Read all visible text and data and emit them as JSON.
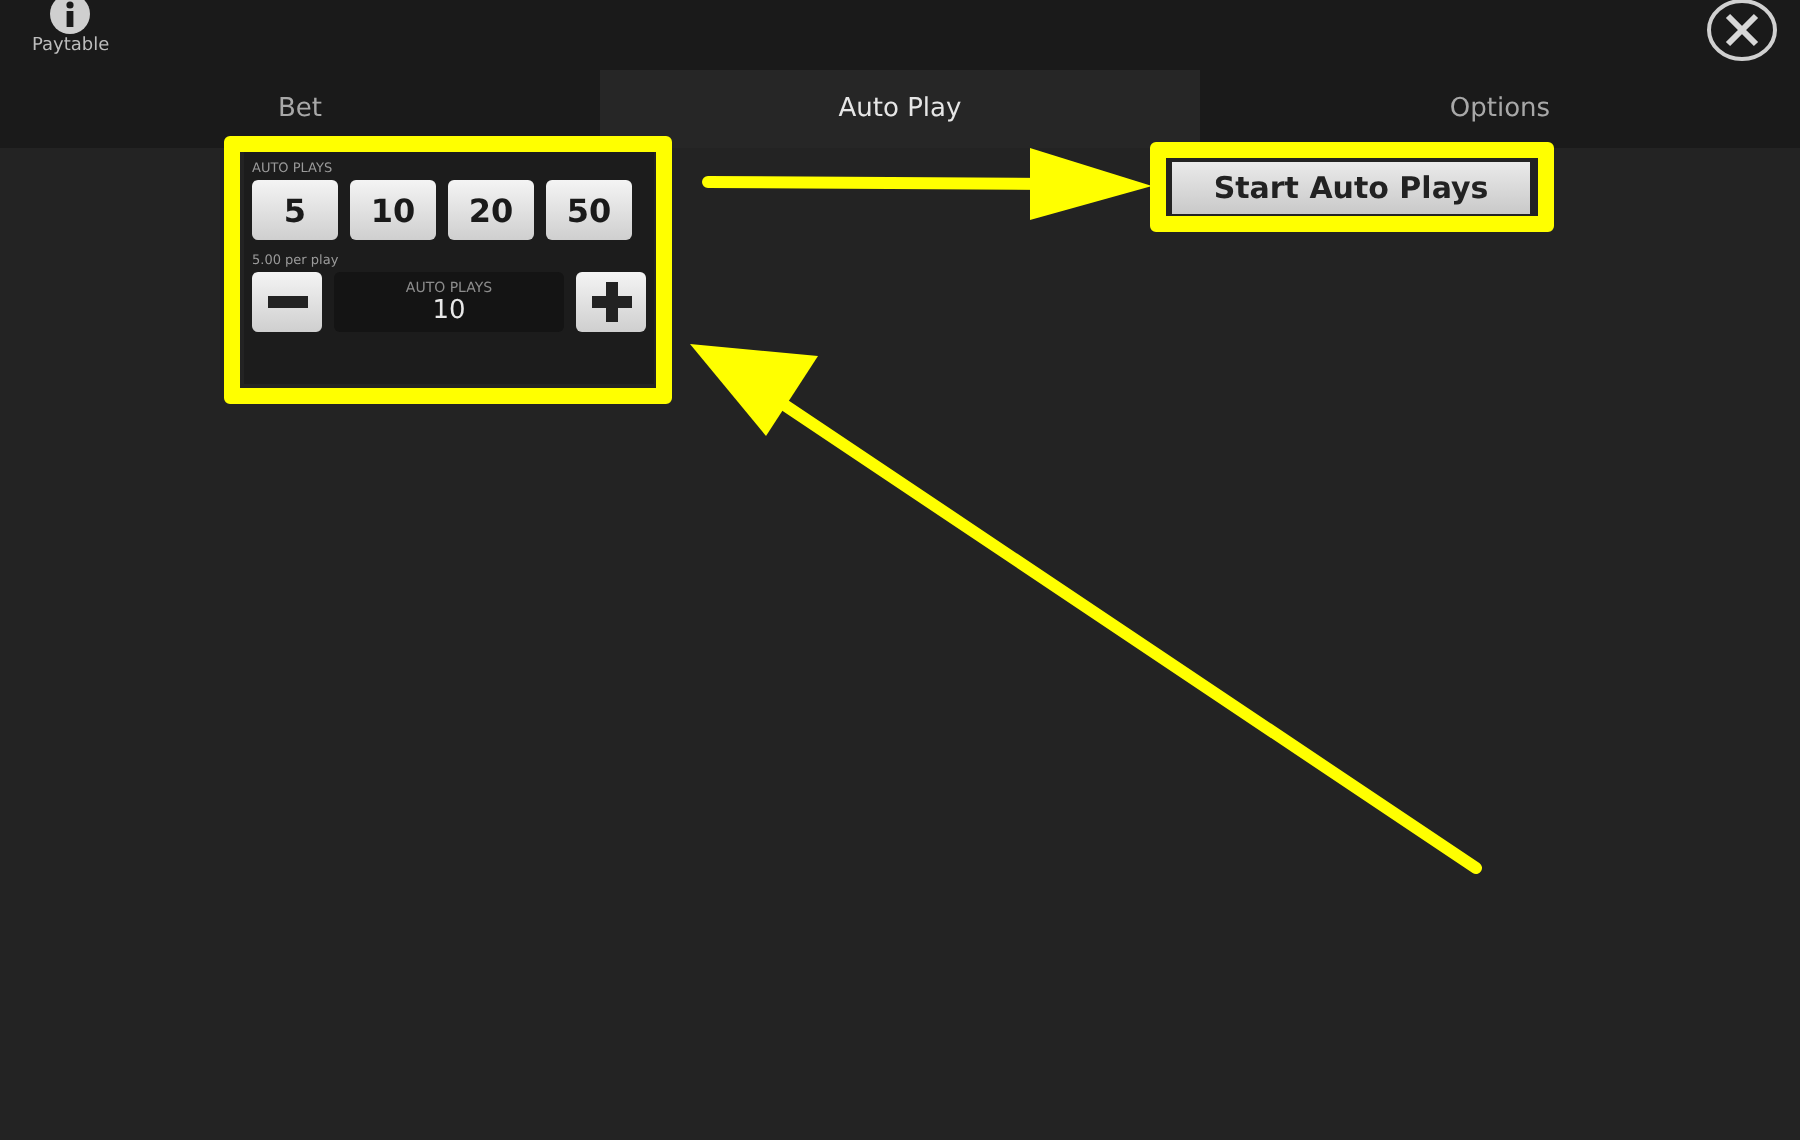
{
  "header": {
    "paytable_label": "Paytable"
  },
  "tabs": [
    {
      "label": "Bet",
      "selected": false
    },
    {
      "label": "Auto Play",
      "selected": true
    },
    {
      "label": "Options",
      "selected": false
    }
  ],
  "auto_play": {
    "label": "AUTO PLAYS",
    "presets": [
      "5",
      "10",
      "20",
      "50"
    ],
    "per_play": "5.00 per play",
    "stepper": {
      "label": "AUTO PLAYS",
      "value": "10"
    },
    "start_button": "Start Auto Plays"
  }
}
